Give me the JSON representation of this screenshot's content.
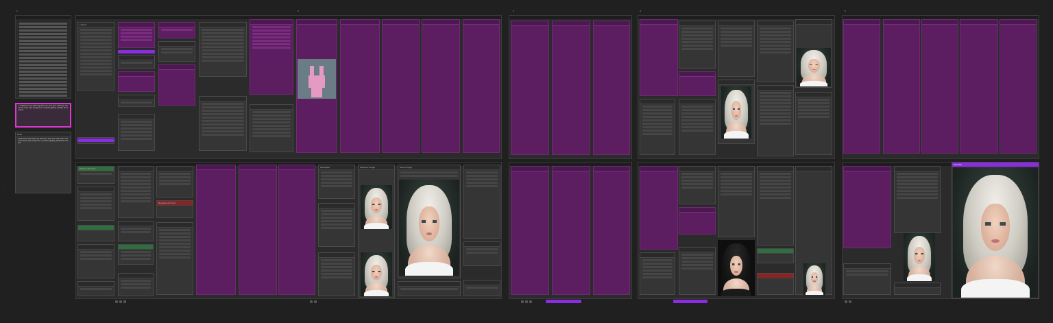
{
  "app": {
    "title": ""
  },
  "workspace_tabs": [
    {
      "label": "1"
    },
    {
      "label": "2"
    },
    {
      "label": "3"
    },
    {
      "label": "4"
    },
    {
      "label": "5"
    }
  ],
  "nodes": {
    "loader_title": "Loader",
    "note_title": "Note",
    "prompt_text": "a beautiful woman with long white hair, blue eyes, soft smile, white lace dress, dark background, cinematic lighting, detailed skin texture",
    "negative_title": "Negative Prompt",
    "positive_title": "Positive Prompt",
    "ksampler_title": "KSampler",
    "save_image_title": "Save Image",
    "preview_image_title": "Preview Image",
    "upscale_title": "Upscale"
  },
  "colors": {
    "canvas": "#202020",
    "group": "#2b2b2b",
    "node": "#353535",
    "magenta": "#5c1e61",
    "accent_purple": "#8b2be2",
    "green_header": "#2f6e3e",
    "red_header": "#8a2323"
  },
  "icons": [
    "gear-icon",
    "close-icon",
    "play-icon"
  ]
}
